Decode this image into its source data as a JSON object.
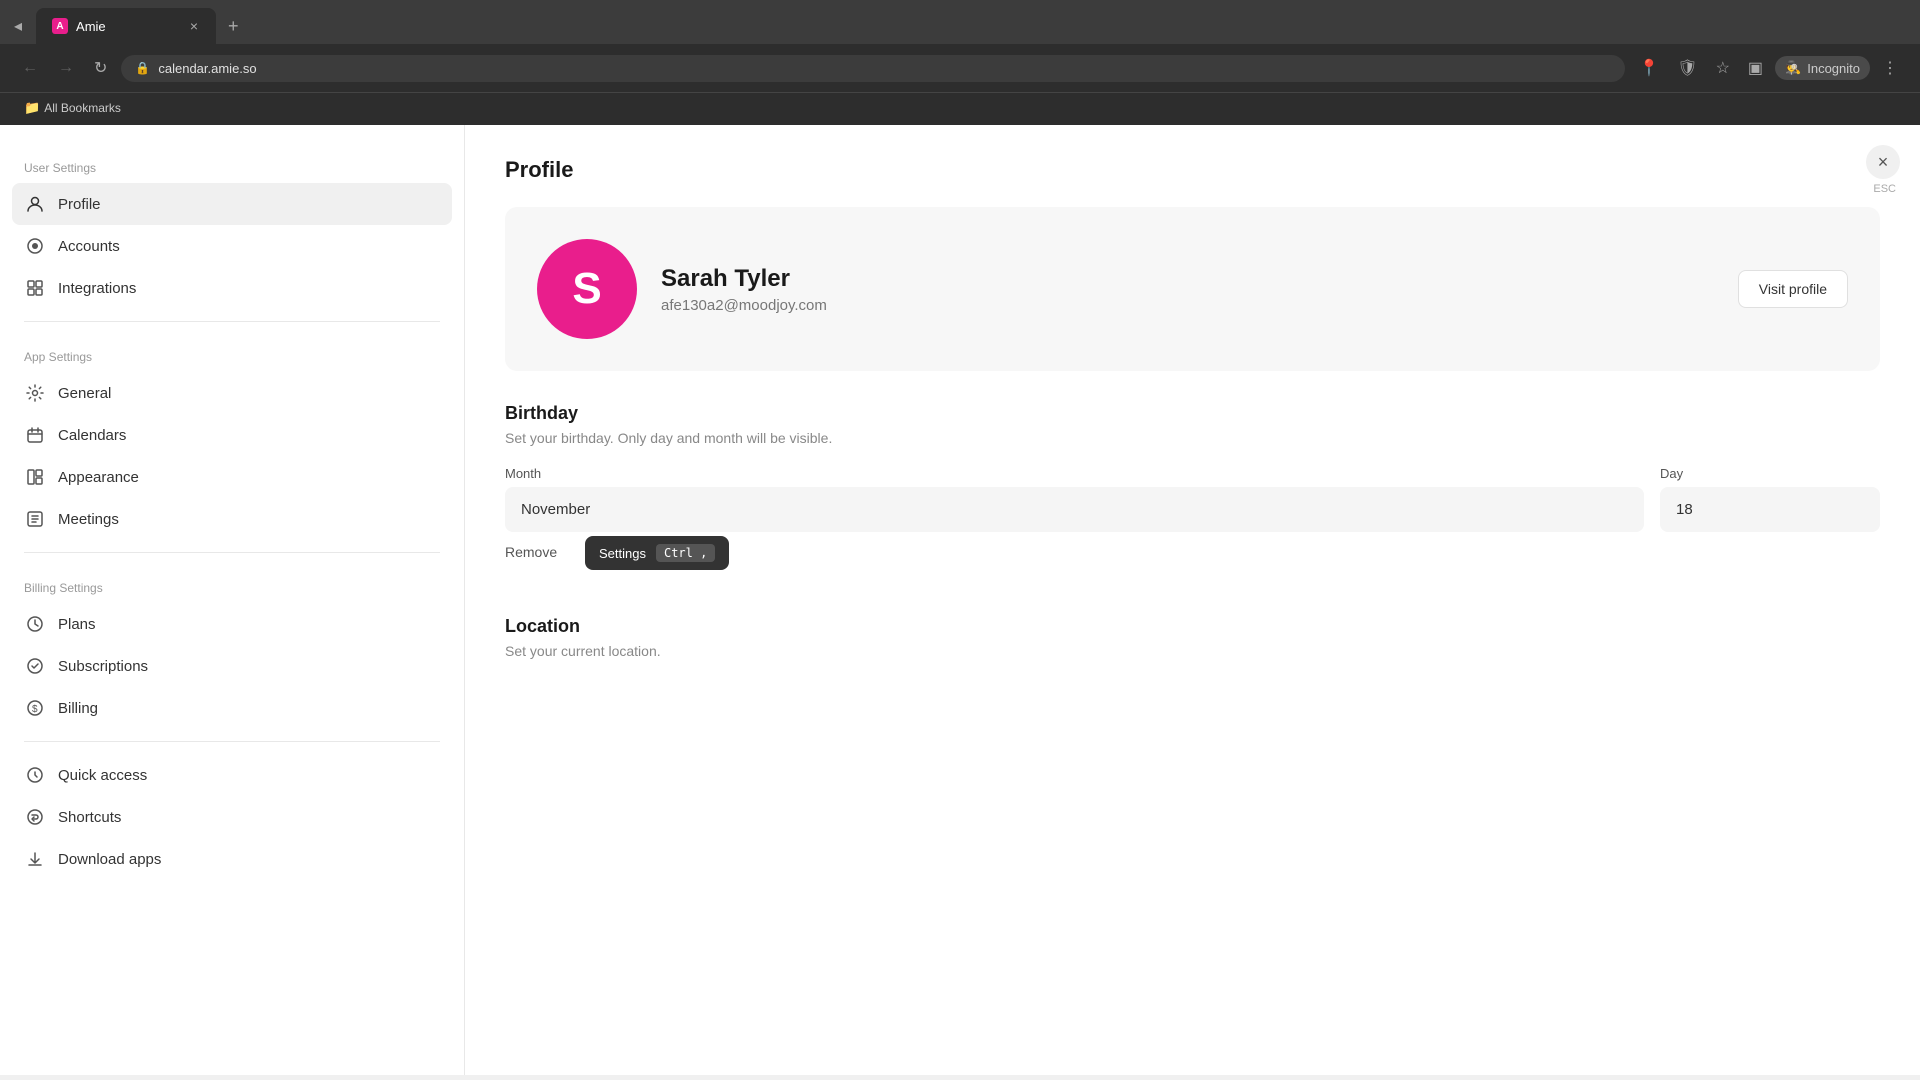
{
  "browser": {
    "tab": {
      "favicon_letter": "A",
      "title": "Amie",
      "close_label": "×"
    },
    "new_tab_label": "+",
    "nav": {
      "back_label": "←",
      "forward_label": "→",
      "refresh_label": "↻",
      "url": "calendar.amie.so"
    },
    "nav_icons": {
      "location": "📍",
      "shield": "🛡",
      "star": "☆",
      "sidebar": "▣"
    },
    "incognito": {
      "icon": "🕵",
      "label": "Incognito"
    },
    "bookmarks_bar": {
      "label": "All Bookmarks",
      "folder_icon": "📁"
    }
  },
  "sidebar": {
    "user_settings_label": "User Settings",
    "items_user": [
      {
        "id": "profile",
        "icon": "👤",
        "label": "Profile",
        "active": true
      },
      {
        "id": "accounts",
        "icon": "●",
        "label": "Accounts",
        "active": false
      },
      {
        "id": "integrations",
        "icon": "⊞",
        "label": "Integrations",
        "active": false
      }
    ],
    "app_settings_label": "App Settings",
    "items_app": [
      {
        "id": "general",
        "icon": "⚙",
        "label": "General",
        "active": false
      },
      {
        "id": "calendars",
        "icon": "📅",
        "label": "Calendars",
        "active": false
      },
      {
        "id": "appearance",
        "icon": "▦",
        "label": "Appearance",
        "active": false
      },
      {
        "id": "meetings",
        "icon": "▣",
        "label": "Meetings",
        "active": false
      }
    ],
    "billing_settings_label": "Billing Settings",
    "items_billing": [
      {
        "id": "plans",
        "icon": "◎",
        "label": "Plans",
        "active": false
      },
      {
        "id": "subscriptions",
        "icon": "◎",
        "label": "Subscriptions",
        "active": false
      },
      {
        "id": "billing",
        "icon": "$",
        "label": "Billing",
        "active": false
      }
    ],
    "items_bottom": [
      {
        "id": "quick-access",
        "icon": "◎",
        "label": "Quick access",
        "active": false
      },
      {
        "id": "shortcuts",
        "icon": "◎",
        "label": "Shortcuts",
        "active": false
      },
      {
        "id": "download-apps",
        "icon": "⬇",
        "label": "Download apps",
        "active": false
      }
    ]
  },
  "main": {
    "page_title": "Profile",
    "close_btn_label": "×",
    "esc_label": "ESC",
    "profile_card": {
      "avatar_letter": "S",
      "name": "Sarah Tyler",
      "email": "afe130a2@moodjoy.com",
      "visit_btn_label": "Visit profile"
    },
    "birthday": {
      "section_title": "Birthday",
      "section_desc": "Set your birthday. Only day and month will be visible.",
      "month_label": "Month",
      "month_value": "November",
      "day_label": "Day",
      "day_value": "18",
      "remove_label": "Remove"
    },
    "tooltip": {
      "label": "Settings",
      "kbd": "Ctrl ,"
    },
    "location": {
      "section_title": "Location",
      "section_desc": "Set your current location."
    }
  }
}
